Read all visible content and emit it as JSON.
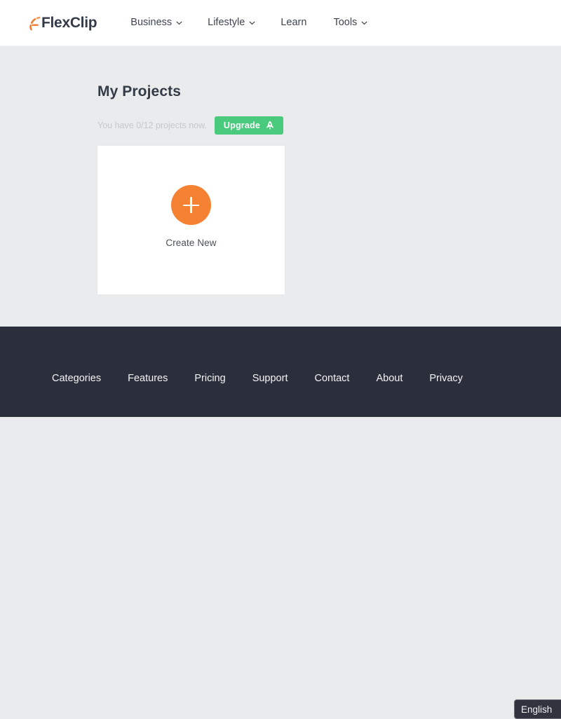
{
  "header": {
    "brand": {
      "name": "FlexClip",
      "mark_color": "#f07c34",
      "text_color": "#343b48"
    },
    "nav": [
      {
        "label": "Business",
        "has_caret": true,
        "icon": "chevron-down-icon"
      },
      {
        "label": "Lifestyle",
        "has_caret": true,
        "icon": "chevron-down-icon"
      },
      {
        "label": "Learn",
        "has_caret": false,
        "icon": ""
      },
      {
        "label": "Tools",
        "has_caret": true,
        "icon": "chevron-down-icon"
      }
    ]
  },
  "main": {
    "title": "My Projects",
    "quota_text": "You have 0/12 projects now.",
    "upgrade": {
      "label": "Upgrade",
      "icon": "rocket-icon",
      "color": "#49ca7d"
    },
    "create_card": {
      "label": "Create New",
      "icon": "plus-icon",
      "accent_color": "#f58232"
    }
  },
  "footer": {
    "background": "#2b2e3b",
    "links": [
      {
        "label": "Categories"
      },
      {
        "label": "Features"
      },
      {
        "label": "Pricing"
      },
      {
        "label": "Support"
      },
      {
        "label": "Contact"
      },
      {
        "label": "About"
      },
      {
        "label": "Privacy"
      }
    ],
    "language": {
      "selected": "English"
    }
  }
}
